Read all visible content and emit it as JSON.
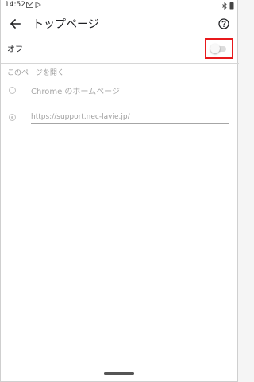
{
  "status_bar": {
    "time": "14:52",
    "left_icons": [
      "gmail-icon",
      "play-store-icon"
    ],
    "right_icons": [
      "bluetooth-icon",
      "battery-icon"
    ]
  },
  "app_bar": {
    "title": "トップページ",
    "back_icon": "back-arrow-icon",
    "help_icon": "help-icon"
  },
  "toggle": {
    "label": "オフ",
    "state": "off"
  },
  "open_page_section": {
    "header": "このページを開く",
    "options": [
      {
        "label": "Chrome のホームページ",
        "selected": false
      },
      {
        "value": "https://support.nec-lavie.jp/",
        "selected": true
      }
    ]
  }
}
